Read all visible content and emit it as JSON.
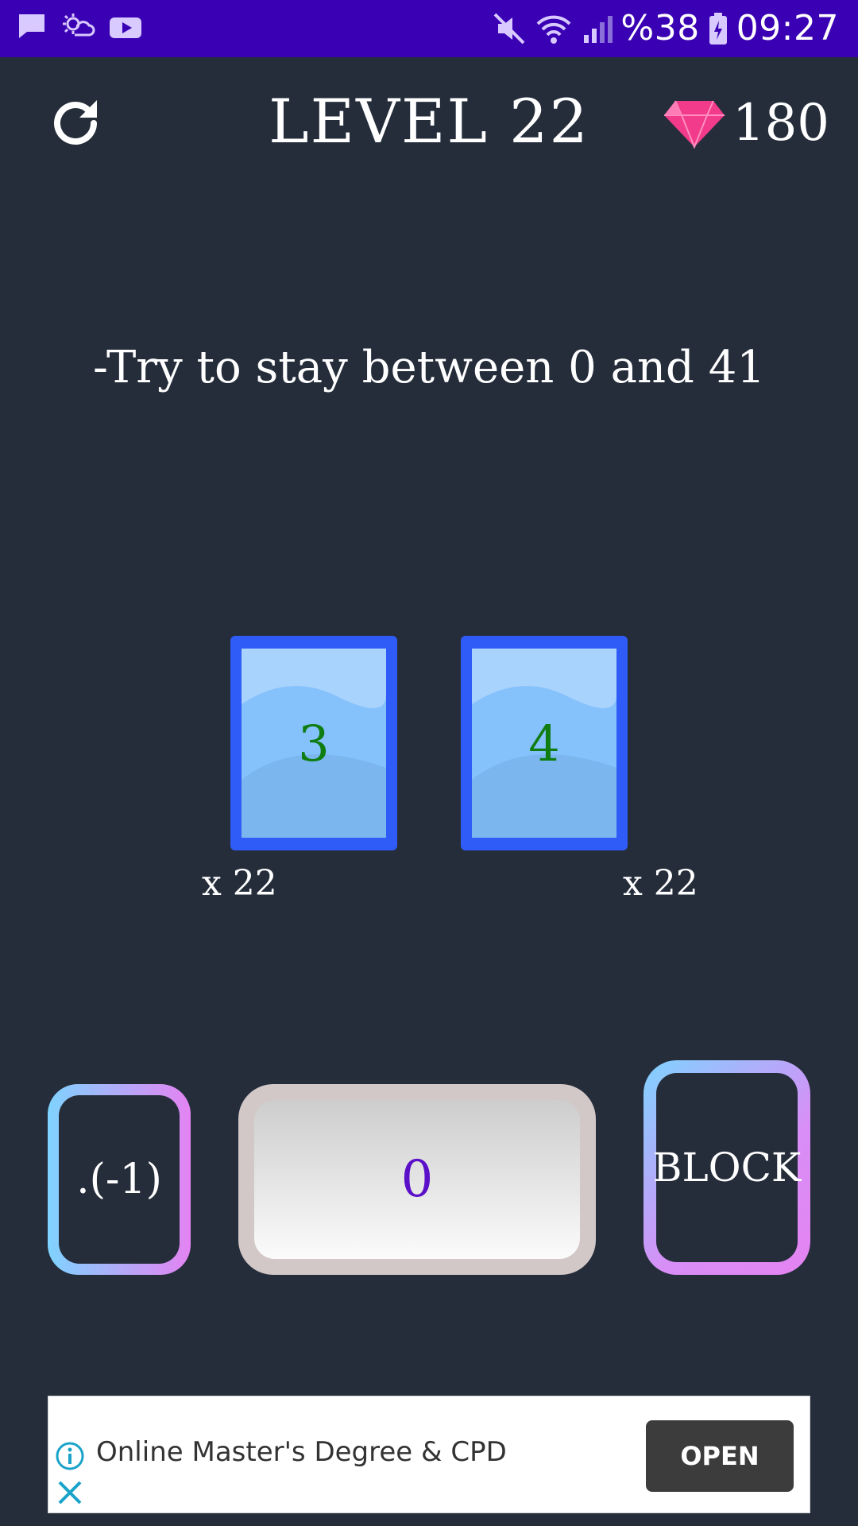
{
  "statusbar": {
    "battery_percent": "%38",
    "time": "09:27",
    "left_icons": [
      "message-icon",
      "weather-icon",
      "youtube-icon"
    ],
    "right_icons": [
      "mute-icon",
      "wifi-icon",
      "signal-icon",
      "battery-icon"
    ]
  },
  "header": {
    "title": "LEVEL 22",
    "gem_count": "180",
    "refresh_icon": "refresh-icon",
    "gem_icon": "gem-icon"
  },
  "hint": "-Try to stay between 0 and 41",
  "cards": [
    {
      "value": "3",
      "multiplier": "x 22"
    },
    {
      "value": "4",
      "multiplier": "x 22"
    }
  ],
  "controls": {
    "negate_label": ".(-1)",
    "display_value": "0",
    "block_label": "BLOCK"
  },
  "ad": {
    "text": "Online Master's Degree & CPD",
    "open_label": "OPEN"
  },
  "colors": {
    "statusbar": "#3a00b4",
    "background": "#252d3b",
    "card_border": "#2f5cf7",
    "card_number": "#0f7d12",
    "display_number": "#5a10c8",
    "gem": "#f23b8a"
  }
}
